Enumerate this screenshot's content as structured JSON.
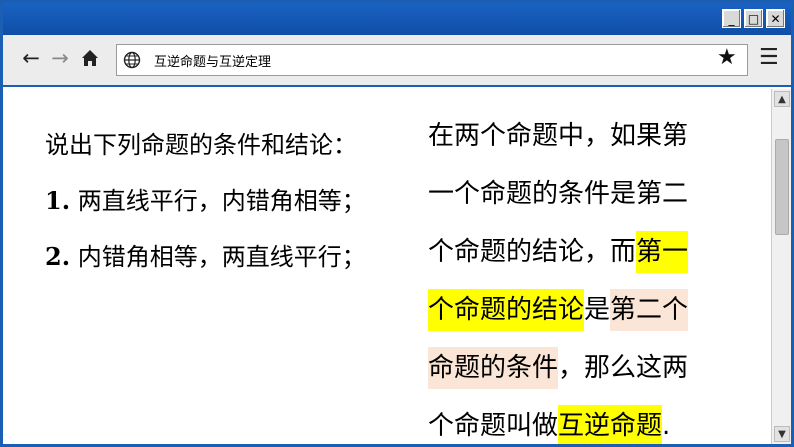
{
  "browser": {
    "url": "互逆命题与互逆定理",
    "controls": {
      "minimize": "_",
      "maximize": "□",
      "close": "✕"
    },
    "nav": {
      "back": "←",
      "forward": "→",
      "home": "⌂"
    },
    "bookmark": "★",
    "menu": "☰",
    "icons": [
      "back-arrow-icon",
      "forward-arrow-icon",
      "home-icon",
      "globe-icon",
      "star-icon",
      "menu-icon"
    ]
  },
  "slide": {
    "prompt": "说出下列命题的条件和结论：",
    "items": [
      {
        "num": "1.",
        "text": " 两直线平行，内错角相等；"
      },
      {
        "num": "2.",
        "text": " 内错角相等，两直线平行；"
      }
    ],
    "definition": {
      "line1": "在两个命题中，如果第",
      "line2": "一个命题的条件是第二",
      "line3_a": "个命题的结论，而",
      "line3_b": "第一",
      "line4_a": "个命题的结论",
      "line4_b": "是",
      "line4_c": "第二个",
      "line5_a": "命题的条件",
      "line5_b": "，那么这两",
      "line6_a": "个命题叫做",
      "line6_b": "互逆命题",
      "line6_c": "."
    },
    "colors": {
      "yellow_highlight": "#ffff00",
      "peach_highlight": "#fbe5d6",
      "frame": "#1b5fb4"
    }
  }
}
